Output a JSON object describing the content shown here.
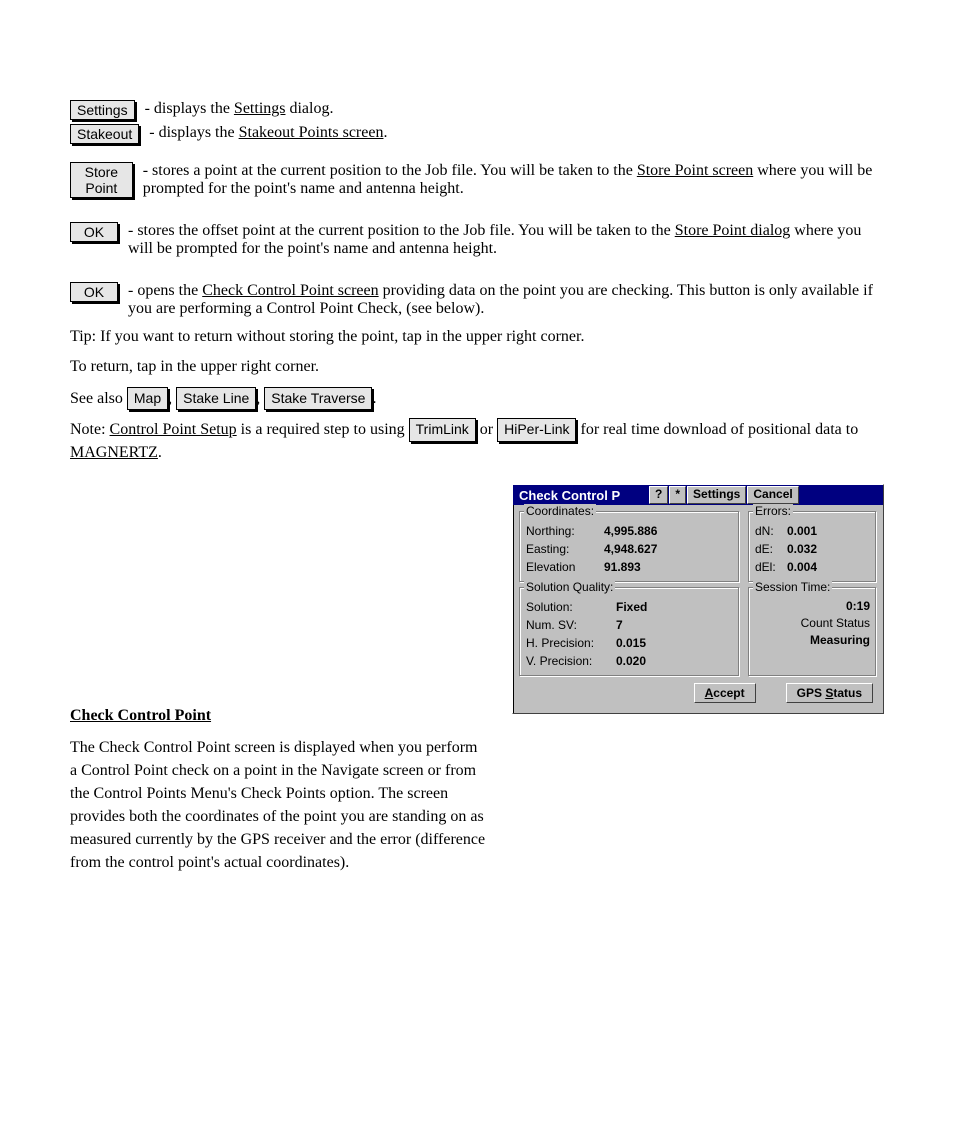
{
  "instructions": {
    "row1_btn": "Settings",
    "row1_text": "- displays the",
    "row1_link": "Settings",
    "row1_tail": " dialog.",
    "row2_btn": "Stakeout",
    "row2_text": "- displays the",
    "row2_link": "Stakeout Points screen",
    "row2_tail": ".",
    "row3_btn": "Store Point",
    "row3_text": "- stores a point at the current position to the Job file. You will be taken to the ",
    "row3_link": "Store Point screen",
    "row3_tail": " where you will be prompted for the point's name and antenna height.",
    "row4_btn": "OK",
    "row4_text": "- stores the offset point at the current position to the Job file. You will be taken to the ",
    "row4_link": "Store Point dialog",
    "row4_tail": " where you will be prompted for the point's name and antenna height.",
    "row5_btn": "OK",
    "row5_text": "- opens the ",
    "row5_link": "Check Control Point screen",
    "row5_tail": " providing data on the point you are checking. This button is only available if you are performing a Control Point Check, (see below).",
    "para_tip": "Tip: If you want to return without storing the point, tap  in the upper right corner.",
    "para_rtn": "To return, tap in the upper right corner.",
    "para_seealso_lead": "See also ",
    "link_map": "Map",
    "link_stakeline": "Stake Line",
    "link_staketrav": "Stake Traverse",
    "para_note": "Note: ",
    "link_cpsetup": "Control Point Setup",
    "para_note_mid": " is a required step to using ",
    "link_trimlink": "TrimLink",
    "para_note_mid2": " or ",
    "link_hiperlink": "HiPer-Link",
    "para_note_mid3": " for real time download of positional data to ",
    "link_magnertz": "MAGNERTZ",
    "para_note_tail": "."
  },
  "section": {
    "heading": "Check Control Point",
    "body": "The Check Control Point screen is displayed when you perform a Control Point check on a point in the Navigate screen or from the Control Points Menu's Check Points option. The screen provides both the coordinates of the point you are standing on as measured currently by the GPS receiver and the error (difference from the control point's actual coordinates)."
  },
  "dialog": {
    "title": "Check Control P",
    "help": "?",
    "star": "*",
    "settings": "Settings",
    "cancel": "Cancel",
    "coords_legend": "Coordinates:",
    "northing_k": "Northing:",
    "northing_v": "4,995.886",
    "easting_k": "Easting:",
    "easting_v": "4,948.627",
    "elev_k": "Elevation",
    "elev_v": "91.893",
    "errors_legend": "Errors:",
    "dn_k": "dN:",
    "dn_v": "0.001",
    "de_k": "dE:",
    "de_v": "0.032",
    "del_k": "dEl:",
    "del_v": "0.004",
    "sq_legend": "Solution Quality:",
    "sol_k": "Solution:",
    "sol_v": "Fixed",
    "sv_k": "Num. SV:",
    "sv_v": "7",
    "hp_k": "H. Precision:",
    "hp_v": "0.015",
    "vp_k": "V. Precision:",
    "vp_v": "0.020",
    "st_legend": "Session Time:",
    "st_time": "0:19",
    "st_count": "Count Status",
    "st_meas": "Measuring",
    "accept": "Accept",
    "gps": "GPS Status"
  }
}
